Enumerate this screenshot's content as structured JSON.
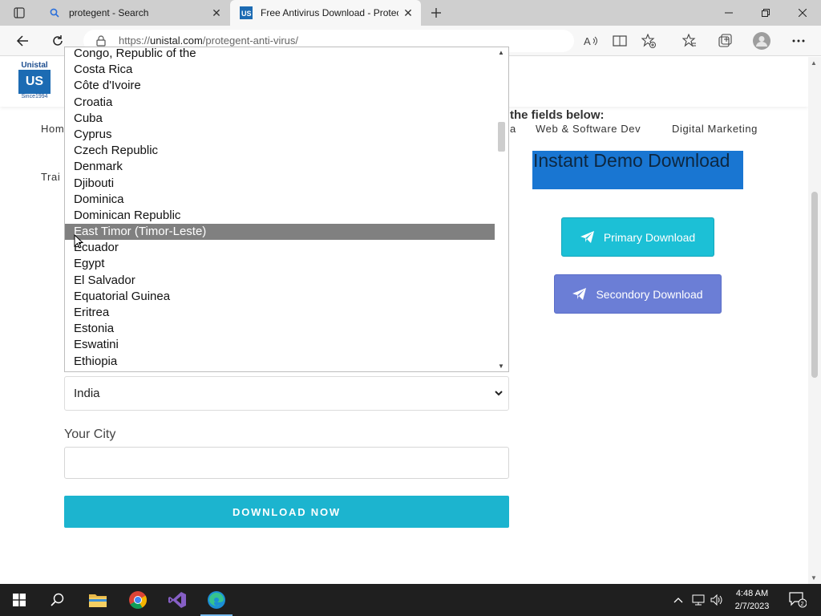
{
  "browser": {
    "tabs": [
      {
        "title": "protegent - Search",
        "active": false
      },
      {
        "title": "Free Antivirus Download - Protec",
        "active": true
      }
    ],
    "url_prefix": "https://",
    "url_host": "unistal.com",
    "url_path": "/protegent-anti-virus/"
  },
  "site": {
    "logo": {
      "top": "Unistal",
      "mark": "US",
      "since": "Since1994"
    },
    "nav": [
      "Hom",
      "a",
      "Web & Software Dev",
      "Digital Marketing",
      "Trai"
    ],
    "fields_title": "the fields below:",
    "demo_title": "Instant Demo Download",
    "primary_button": "Primary Download",
    "secondary_button": "Secondory Download",
    "country_value": "India",
    "city_label": "Your City",
    "city_value": "",
    "download_button": "DOWNLOAD NOW"
  },
  "dropdown": {
    "items": [
      "Congo, Republic of the",
      "Costa Rica",
      "Côte d'Ivoire",
      "Croatia",
      "Cuba",
      "Cyprus",
      "Czech Republic",
      "Denmark",
      "Djibouti",
      "Dominica",
      "Dominican Republic",
      "East Timor (Timor-Leste)",
      "Ecuador",
      "Egypt",
      "El Salvador",
      "Equatorial Guinea",
      "Eritrea",
      "Estonia",
      "Eswatini",
      "Ethiopia"
    ],
    "highlighted": "East Timor (Timor-Leste)"
  },
  "taskbar": {
    "time": "4:48 AM",
    "date": "2/7/2023",
    "notifications": "2"
  },
  "colors": {
    "accent_teal": "#1cb4cf",
    "secondary_blue": "#6b7ed6",
    "highlight_blue": "#1976d2"
  }
}
